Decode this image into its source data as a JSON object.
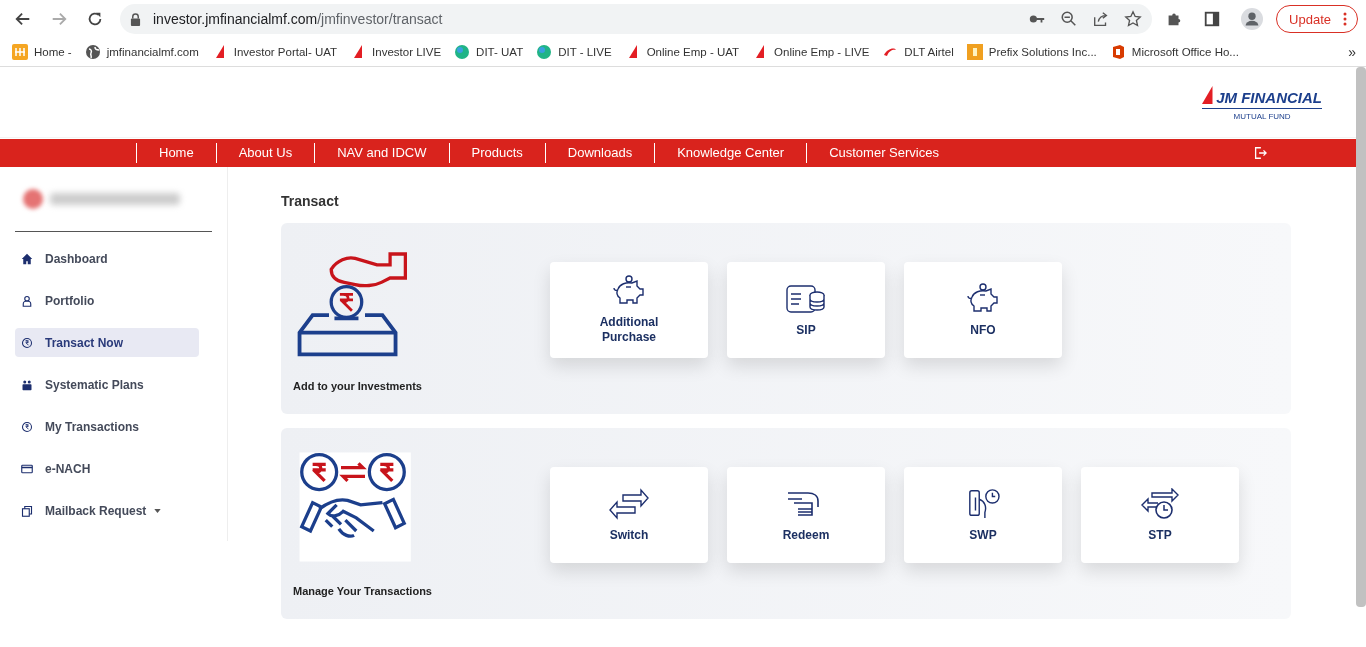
{
  "browser": {
    "url_host": "investor.jmfinancialmf.com",
    "url_path": "/jmfinvestor/transact",
    "update_label": "Update",
    "bookmarks": [
      {
        "label": "Home -",
        "kind": "grid"
      },
      {
        "label": "jmfinancialmf.com",
        "kind": "globe"
      },
      {
        "label": "Investor Portal- UAT",
        "kind": "sail"
      },
      {
        "label": "Investor LIVE",
        "kind": "sail"
      },
      {
        "label": "DIT- UAT",
        "kind": "ball"
      },
      {
        "label": "DIT - LIVE",
        "kind": "ball"
      },
      {
        "label": "Online Emp - UAT",
        "kind": "sail"
      },
      {
        "label": "Online Emp - LIVE",
        "kind": "sail"
      },
      {
        "label": "DLT Airtel",
        "kind": "swoosh"
      },
      {
        "label": "Prefix Solutions Inc...",
        "kind": "square"
      },
      {
        "label": "Microsoft Office Ho...",
        "kind": "office"
      }
    ],
    "more": "»"
  },
  "logo": {
    "name": "JM FINANCIAL",
    "tagline": "MUTUAL FUND"
  },
  "nav": [
    "Home",
    "About Us",
    "NAV and IDCW",
    "Products",
    "Downloads",
    "Knowledge Center",
    "Customer Services"
  ],
  "sidebar": {
    "items": [
      {
        "label": "Dashboard",
        "kind": "home",
        "selected": false,
        "has_menu": false
      },
      {
        "label": "Portfolio",
        "kind": "person",
        "selected": false,
        "has_menu": false
      },
      {
        "label": "Transact Now",
        "kind": "rupee",
        "selected": true,
        "has_menu": false
      },
      {
        "label": "Systematic Plans",
        "kind": "people",
        "selected": false,
        "has_menu": false
      },
      {
        "label": "My Transactions",
        "kind": "rupee",
        "selected": false,
        "has_menu": false
      },
      {
        "label": "e-NACH",
        "kind": "card",
        "selected": false,
        "has_menu": false
      },
      {
        "label": "Mailback Request",
        "kind": "copy",
        "selected": false,
        "has_menu": true
      }
    ]
  },
  "page_title": "Transact",
  "groups": [
    {
      "caption": "Add to your Investments",
      "kind": "deposit",
      "tiles": [
        {
          "label": "Additional Purchase",
          "kind": "piggy"
        },
        {
          "label": "SIP",
          "kind": "coins"
        },
        {
          "label": "NFO",
          "kind": "piggy"
        }
      ]
    },
    {
      "caption": "Manage Your Transactions",
      "kind": "handshake",
      "tiles": [
        {
          "label": "Switch",
          "kind": "swap"
        },
        {
          "label": "Redeem",
          "kind": "hand"
        },
        {
          "label": "SWP",
          "kind": "phone"
        },
        {
          "label": "STP",
          "kind": "clockswap"
        }
      ]
    }
  ]
}
